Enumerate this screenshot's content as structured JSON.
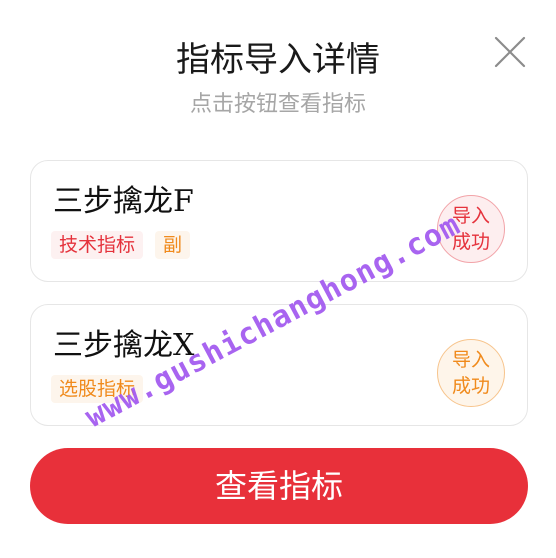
{
  "dialog": {
    "title": "指标导入详情",
    "subtitle": "点击按钮查看指标",
    "close_icon": "close-icon"
  },
  "indicators": [
    {
      "name": "三步擒龙F",
      "tags": [
        {
          "label": "技术指标",
          "color": "#e5323c"
        },
        {
          "label": "副",
          "color": "#f08a1c"
        }
      ],
      "status_line1": "导入",
      "status_line2": "成功",
      "status_color": "#e5323c"
    },
    {
      "name": "三步擒龙X",
      "tags": [
        {
          "label": "选股指标",
          "color": "#f08a1c"
        }
      ],
      "status_line1": "导入",
      "status_line2": "成功",
      "status_color": "#f08a1c"
    }
  ],
  "action": {
    "view_label": "查看指标",
    "color": "#e8303a"
  },
  "watermark": "www.gushichanghong.com"
}
